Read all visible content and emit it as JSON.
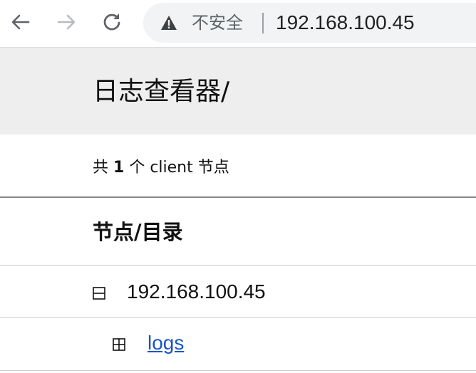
{
  "browser": {
    "security_label": "不安全",
    "url": "192.168.100.45"
  },
  "page": {
    "title": "日志查看器/",
    "summary": {
      "prefix": "共",
      "count": "1",
      "suffix": "个 client 节点"
    },
    "column_header": "节点/目录"
  },
  "tree": {
    "node": {
      "toggle": "⊟",
      "label": "192.168.100.45"
    },
    "directories": [
      {
        "toggle": "⊞",
        "label": "logs"
      }
    ]
  },
  "colors": {
    "link": "#1a55c7",
    "header_bg": "#eeeeee",
    "omnibox_bg": "#f1f3f4"
  }
}
